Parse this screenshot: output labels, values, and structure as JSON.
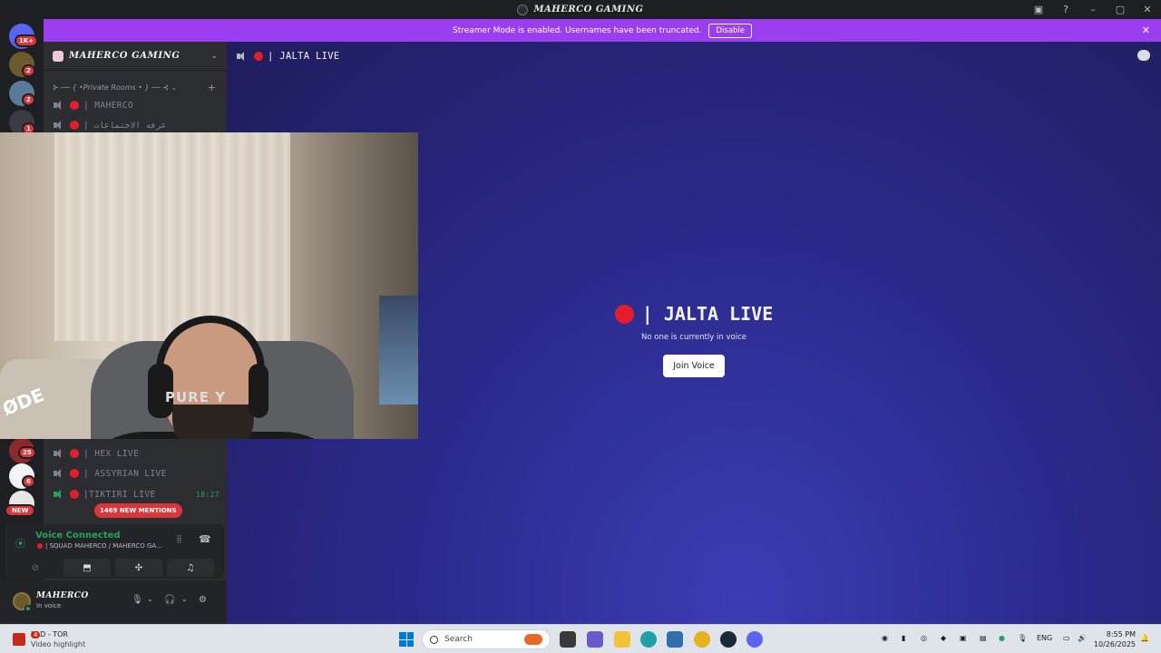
{
  "window": {
    "title": "MAHERCO GAMING"
  },
  "rail": {
    "badges": [
      "1K+",
      "2",
      "2",
      "1",
      "25",
      "6"
    ],
    "new_label": "NEW"
  },
  "banner": {
    "message": "Streamer Mode is enabled. Usernames have been truncated.",
    "disable_label": "Disable"
  },
  "sidebar": {
    "server_name": "MAHERCO GAMING",
    "category": "⊱ ── { •Private Rooms • } ── ⊰ ⌄",
    "channels_top": [
      {
        "name": "| MAHERCO"
      },
      {
        "name": "| عرفه الاجتماعات"
      }
    ],
    "channels_bottom": [
      {
        "name": "| HEX LIVE",
        "time": ""
      },
      {
        "name": "| ASSYRIAN LIVE",
        "time": ""
      },
      {
        "name": "|TIKTIRI LIVE",
        "time": "18:27"
      }
    ],
    "mentions_label": "1469 NEW MENTIONS"
  },
  "voice": {
    "status": "Voice Connected",
    "channel": "| SQUAD MAHERCO / MAHERCO GA..."
  },
  "user": {
    "name": "MAHERCO",
    "status": "In voice"
  },
  "main": {
    "channel_name": "| JALTA LIVE",
    "title": "| JALTA LIVE",
    "empty_text": "No one is currently in voice",
    "join_label": "Join Voice"
  },
  "webcam": {
    "mic_brand": "ØDE",
    "shirt_text": "PURE  Y"
  },
  "taskbar": {
    "notif_badge": "4",
    "widget_title": "LAD - TOR",
    "widget_sub": "Video highlight",
    "search_placeholder": "Search",
    "lang": "ENG",
    "time": "8:55 PM",
    "date": "10/26/2025"
  },
  "colors": {
    "banner": "#9b3ef0",
    "live_dot": "#e51d2b",
    "voice_green": "#23a55a",
    "badge_red": "#da373c"
  }
}
